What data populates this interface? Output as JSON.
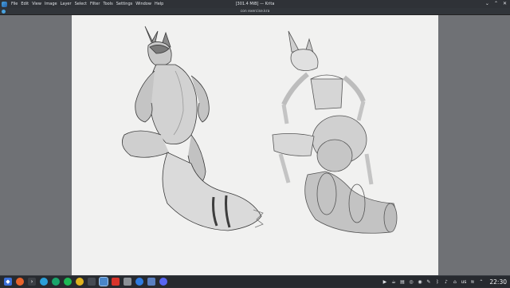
{
  "window": {
    "title": "[301.4 MiB] — Krita",
    "controls": [
      "chevron-icon",
      "minimize-icon",
      "close-icon"
    ]
  },
  "menu": {
    "items": [
      "File",
      "Edit",
      "View",
      "Image",
      "Layer",
      "Select",
      "Filter",
      "Tools",
      "Settings",
      "Window",
      "Help"
    ]
  },
  "document": {
    "tab_name": "con exercise.kra"
  },
  "taskbar": {
    "apps": [
      "app-launcher-icon",
      "firefox-icon",
      "terminal-icon",
      "telegram-icon",
      "app-green-icon",
      "spotify-icon",
      "app-yellow-icon",
      "app-dark-icon",
      "krita-icon",
      "app-red-icon",
      "app-gray-icon",
      "app-blue-icon",
      "file-manager-icon",
      "discord-icon"
    ],
    "tray": {
      "keyboard_layout": "us",
      "clock": "22:30"
    }
  },
  "colors": {
    "panel_bg": "#2f3237",
    "workspace_bg": "#6f7175",
    "canvas_bg": "#f1f1f0"
  }
}
